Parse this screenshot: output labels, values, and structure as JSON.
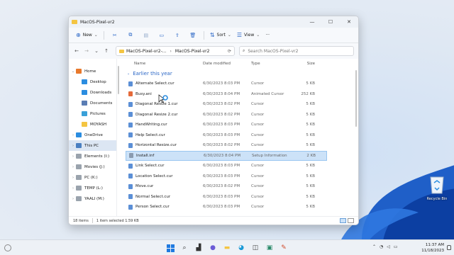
{
  "window": {
    "title": "MacOS-Pixel-vr2",
    "controls": {
      "minimize": "—",
      "maximize": "☐",
      "close": "✕"
    }
  },
  "toolbar": {
    "new_label": "New",
    "sort_label": "Sort",
    "view_label": "View",
    "more_label": "···"
  },
  "address": {
    "crumbs": [
      "MacOS-Pixel-vr2-...",
      "MacOS-Pixel-vr2"
    ],
    "search_placeholder": "Search MacOS-Pixel-vr2"
  },
  "sidebar": {
    "items": [
      {
        "label": "Home",
        "level": 0,
        "chev": "⌄",
        "color": "#e8792c",
        "active": false
      },
      {
        "label": "Desktop",
        "level": 1,
        "chev": "",
        "color": "#2b8de0",
        "active": false
      },
      {
        "label": "Downloads",
        "level": 1,
        "chev": "",
        "color": "#2b8de0",
        "active": false
      },
      {
        "label": "Documents",
        "level": 1,
        "chev": "",
        "color": "#5a7db4",
        "active": false
      },
      {
        "label": "Pictures",
        "level": 1,
        "chev": "",
        "color": "#3aa0d8",
        "active": false
      },
      {
        "label": "MOYASH",
        "level": 1,
        "chev": "",
        "color": "#f4c542",
        "active": false
      },
      {
        "label": "OneDrive",
        "level": 0,
        "chev": "›",
        "color": "#2b8de0",
        "active": false
      },
      {
        "label": "This PC",
        "level": 0,
        "chev": "›",
        "color": "#4a7fc1",
        "active": true
      },
      {
        "label": "Elements (I:)",
        "level": 0,
        "chev": "›",
        "color": "#9aa3ad",
        "active": false
      },
      {
        "label": "Movies (J:)",
        "level": 0,
        "chev": "›",
        "color": "#9aa3ad",
        "active": false
      },
      {
        "label": "PC (K:)",
        "level": 0,
        "chev": "›",
        "color": "#9aa3ad",
        "active": false
      },
      {
        "label": "TEMP (L:)",
        "level": 0,
        "chev": "›",
        "color": "#9aa3ad",
        "active": false
      },
      {
        "label": "YAALI (M:)",
        "level": 0,
        "chev": "›",
        "color": "#9aa3ad",
        "active": false
      }
    ]
  },
  "columns": {
    "name": "Name",
    "date": "Date modified",
    "type": "Type",
    "size": "Size"
  },
  "group_label": "Earlier this year",
  "files": [
    {
      "name": "Alternate Select.cur",
      "date": "6/30/2023 8:03 PM",
      "type": "Cursor",
      "size": "5 KB",
      "color": "#5b8fd6",
      "selected": false
    },
    {
      "name": "Busy.ani",
      "date": "6/30/2023 8:04 PM",
      "type": "Animated Cursor",
      "size": "252 KB",
      "color": "#e56a3a",
      "selected": false
    },
    {
      "name": "Diagonal Resize 1.cur",
      "date": "6/30/2023 8:02 PM",
      "type": "Cursor",
      "size": "5 KB",
      "color": "#5b8fd6",
      "selected": false
    },
    {
      "name": "Diagonal Resize 2.cur",
      "date": "6/30/2023 8:02 PM",
      "type": "Cursor",
      "size": "5 KB",
      "color": "#5b8fd6",
      "selected": false
    },
    {
      "name": "HandWriting.cur",
      "date": "6/30/2023 8:03 PM",
      "type": "Cursor",
      "size": "5 KB",
      "color": "#5b8fd6",
      "selected": false
    },
    {
      "name": "Help Select.cur",
      "date": "6/30/2023 8:03 PM",
      "type": "Cursor",
      "size": "5 KB",
      "color": "#5b8fd6",
      "selected": false
    },
    {
      "name": "Horizontal Resize.cur",
      "date": "6/30/2023 8:02 PM",
      "type": "Cursor",
      "size": "5 KB",
      "color": "#5b8fd6",
      "selected": false
    },
    {
      "name": "Install.inf",
      "date": "6/30/2023 8:04 PM",
      "type": "Setup Information",
      "size": "2 KB",
      "color": "#8a9bb0",
      "selected": true
    },
    {
      "name": "Link Select.cur",
      "date": "6/30/2023 8:03 PM",
      "type": "Cursor",
      "size": "5 KB",
      "color": "#5b8fd6",
      "selected": false
    },
    {
      "name": "Location Select.cur",
      "date": "6/30/2023 8:03 PM",
      "type": "Cursor",
      "size": "5 KB",
      "color": "#5b8fd6",
      "selected": false
    },
    {
      "name": "Move.cur",
      "date": "6/30/2023 8:02 PM",
      "type": "Cursor",
      "size": "5 KB",
      "color": "#5b8fd6",
      "selected": false
    },
    {
      "name": "Normal Select.cur",
      "date": "6/30/2023 8:03 PM",
      "type": "Cursor",
      "size": "5 KB",
      "color": "#5b8fd6",
      "selected": false
    },
    {
      "name": "Person Select.cur",
      "date": "6/30/2023 8:03 PM",
      "type": "Cursor",
      "size": "5 KB",
      "color": "#5b8fd6",
      "selected": false
    }
  ],
  "status": {
    "items": "18 items",
    "selected": "1 item selected  1.59 KB"
  },
  "desktop": {
    "recycle_label": "Recycle Bin"
  },
  "taskbar": {
    "time": "11:37 AM",
    "date": "11/18/2023"
  }
}
